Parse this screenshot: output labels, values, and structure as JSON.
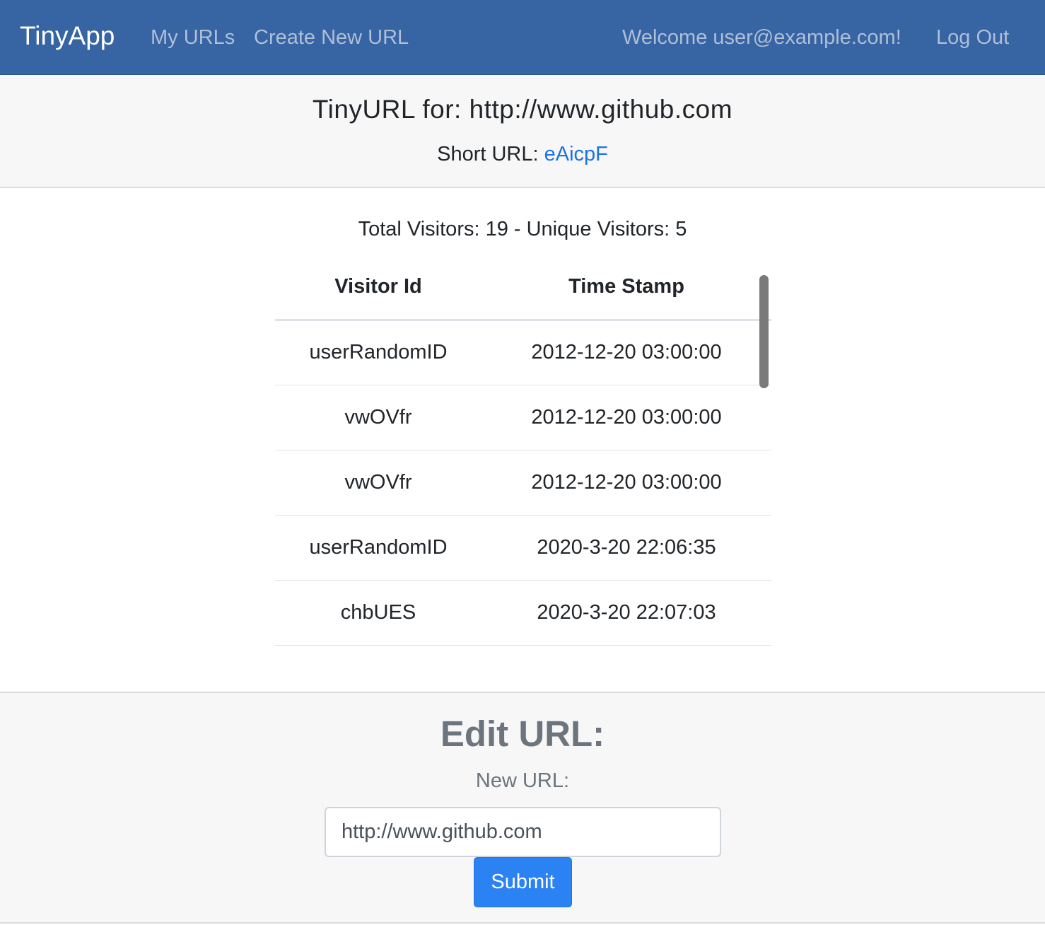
{
  "navbar": {
    "brand": "TinyApp",
    "my_urls": "My URLs",
    "create_new_url": "Create New URL",
    "welcome": "Welcome user@example.com!",
    "logout": "Log Out"
  },
  "header": {
    "title": "TinyURL for: http://www.github.com",
    "short_url_label": "Short URL: ",
    "short_url_value": "eAicpF"
  },
  "stats": {
    "summary": "Total Visitors: 19 - Unique Visitors: 5"
  },
  "table": {
    "columns": [
      "Visitor Id",
      "Time Stamp"
    ],
    "rows": [
      {
        "visitor_id": "userRandomID",
        "timestamp": "2012-12-20 03:00:00"
      },
      {
        "visitor_id": "vwOVfr",
        "timestamp": "2012-12-20 03:00:00"
      },
      {
        "visitor_id": "vwOVfr",
        "timestamp": "2012-12-20 03:00:00"
      },
      {
        "visitor_id": "userRandomID",
        "timestamp": "2020-3-20 22:06:35"
      },
      {
        "visitor_id": "chbUES",
        "timestamp": "2020-3-20 22:07:03"
      }
    ]
  },
  "edit": {
    "title": "Edit URL:",
    "label": "New URL:",
    "input_value": "http://www.github.com",
    "submit": "Submit"
  },
  "colors": {
    "navbar_bg": "#3764a2",
    "link_blue": "#1a73e8",
    "button_blue": "#2b82f2",
    "muted_text": "#6c757d"
  }
}
